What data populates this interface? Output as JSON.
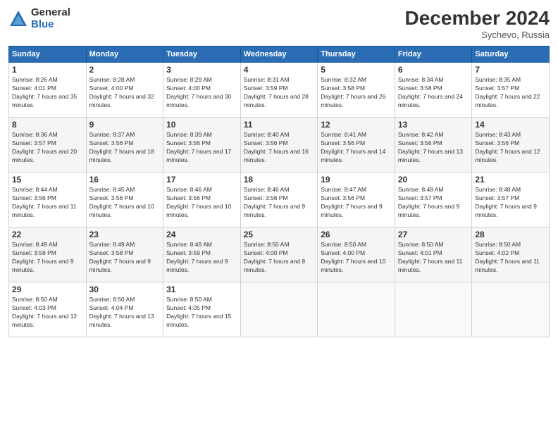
{
  "logo": {
    "general": "General",
    "blue": "Blue"
  },
  "title": "December 2024",
  "location": "Sychevo, Russia",
  "headers": [
    "Sunday",
    "Monday",
    "Tuesday",
    "Wednesday",
    "Thursday",
    "Friday",
    "Saturday"
  ],
  "weeks": [
    [
      {
        "day": "1",
        "sunrise": "Sunrise: 8:26 AM",
        "sunset": "Sunset: 4:01 PM",
        "daylight": "Daylight: 7 hours and 35 minutes."
      },
      {
        "day": "2",
        "sunrise": "Sunrise: 8:28 AM",
        "sunset": "Sunset: 4:00 PM",
        "daylight": "Daylight: 7 hours and 32 minutes."
      },
      {
        "day": "3",
        "sunrise": "Sunrise: 8:29 AM",
        "sunset": "Sunset: 4:00 PM",
        "daylight": "Daylight: 7 hours and 30 minutes."
      },
      {
        "day": "4",
        "sunrise": "Sunrise: 8:31 AM",
        "sunset": "Sunset: 3:59 PM",
        "daylight": "Daylight: 7 hours and 28 minutes."
      },
      {
        "day": "5",
        "sunrise": "Sunrise: 8:32 AM",
        "sunset": "Sunset: 3:58 PM",
        "daylight": "Daylight: 7 hours and 26 minutes."
      },
      {
        "day": "6",
        "sunrise": "Sunrise: 8:34 AM",
        "sunset": "Sunset: 3:58 PM",
        "daylight": "Daylight: 7 hours and 24 minutes."
      },
      {
        "day": "7",
        "sunrise": "Sunrise: 8:35 AM",
        "sunset": "Sunset: 3:57 PM",
        "daylight": "Daylight: 7 hours and 22 minutes."
      }
    ],
    [
      {
        "day": "8",
        "sunrise": "Sunrise: 8:36 AM",
        "sunset": "Sunset: 3:57 PM",
        "daylight": "Daylight: 7 hours and 20 minutes."
      },
      {
        "day": "9",
        "sunrise": "Sunrise: 8:37 AM",
        "sunset": "Sunset: 3:56 PM",
        "daylight": "Daylight: 7 hours and 18 minutes."
      },
      {
        "day": "10",
        "sunrise": "Sunrise: 8:39 AM",
        "sunset": "Sunset: 3:56 PM",
        "daylight": "Daylight: 7 hours and 17 minutes."
      },
      {
        "day": "11",
        "sunrise": "Sunrise: 8:40 AM",
        "sunset": "Sunset: 3:56 PM",
        "daylight": "Daylight: 7 hours and 16 minutes."
      },
      {
        "day": "12",
        "sunrise": "Sunrise: 8:41 AM",
        "sunset": "Sunset: 3:56 PM",
        "daylight": "Daylight: 7 hours and 14 minutes."
      },
      {
        "day": "13",
        "sunrise": "Sunrise: 8:42 AM",
        "sunset": "Sunset: 3:56 PM",
        "daylight": "Daylight: 7 hours and 13 minutes."
      },
      {
        "day": "14",
        "sunrise": "Sunrise: 8:43 AM",
        "sunset": "Sunset: 3:56 PM",
        "daylight": "Daylight: 7 hours and 12 minutes."
      }
    ],
    [
      {
        "day": "15",
        "sunrise": "Sunrise: 8:44 AM",
        "sunset": "Sunset: 3:56 PM",
        "daylight": "Daylight: 7 hours and 11 minutes."
      },
      {
        "day": "16",
        "sunrise": "Sunrise: 8:45 AM",
        "sunset": "Sunset: 3:56 PM",
        "daylight": "Daylight: 7 hours and 10 minutes."
      },
      {
        "day": "17",
        "sunrise": "Sunrise: 8:46 AM",
        "sunset": "Sunset: 3:56 PM",
        "daylight": "Daylight: 7 hours and 10 minutes."
      },
      {
        "day": "18",
        "sunrise": "Sunrise: 8:46 AM",
        "sunset": "Sunset: 3:56 PM",
        "daylight": "Daylight: 7 hours and 9 minutes."
      },
      {
        "day": "19",
        "sunrise": "Sunrise: 8:47 AM",
        "sunset": "Sunset: 3:56 PM",
        "daylight": "Daylight: 7 hours and 9 minutes."
      },
      {
        "day": "20",
        "sunrise": "Sunrise: 8:48 AM",
        "sunset": "Sunset: 3:57 PM",
        "daylight": "Daylight: 7 hours and 9 minutes."
      },
      {
        "day": "21",
        "sunrise": "Sunrise: 8:48 AM",
        "sunset": "Sunset: 3:57 PM",
        "daylight": "Daylight: 7 hours and 9 minutes."
      }
    ],
    [
      {
        "day": "22",
        "sunrise": "Sunrise: 8:49 AM",
        "sunset": "Sunset: 3:58 PM",
        "daylight": "Daylight: 7 hours and 9 minutes."
      },
      {
        "day": "23",
        "sunrise": "Sunrise: 8:49 AM",
        "sunset": "Sunset: 3:58 PM",
        "daylight": "Daylight: 7 hours and 9 minutes."
      },
      {
        "day": "24",
        "sunrise": "Sunrise: 8:49 AM",
        "sunset": "Sunset: 3:59 PM",
        "daylight": "Daylight: 7 hours and 9 minutes."
      },
      {
        "day": "25",
        "sunrise": "Sunrise: 8:50 AM",
        "sunset": "Sunset: 4:00 PM",
        "daylight": "Daylight: 7 hours and 9 minutes."
      },
      {
        "day": "26",
        "sunrise": "Sunrise: 8:50 AM",
        "sunset": "Sunset: 4:00 PM",
        "daylight": "Daylight: 7 hours and 10 minutes."
      },
      {
        "day": "27",
        "sunrise": "Sunrise: 8:50 AM",
        "sunset": "Sunset: 4:01 PM",
        "daylight": "Daylight: 7 hours and 11 minutes."
      },
      {
        "day": "28",
        "sunrise": "Sunrise: 8:50 AM",
        "sunset": "Sunset: 4:02 PM",
        "daylight": "Daylight: 7 hours and 11 minutes."
      }
    ],
    [
      {
        "day": "29",
        "sunrise": "Sunrise: 8:50 AM",
        "sunset": "Sunset: 4:03 PM",
        "daylight": "Daylight: 7 hours and 12 minutes."
      },
      {
        "day": "30",
        "sunrise": "Sunrise: 8:50 AM",
        "sunset": "Sunset: 4:04 PM",
        "daylight": "Daylight: 7 hours and 13 minutes."
      },
      {
        "day": "31",
        "sunrise": "Sunrise: 8:50 AM",
        "sunset": "Sunset: 4:05 PM",
        "daylight": "Daylight: 7 hours and 15 minutes."
      },
      null,
      null,
      null,
      null
    ]
  ]
}
